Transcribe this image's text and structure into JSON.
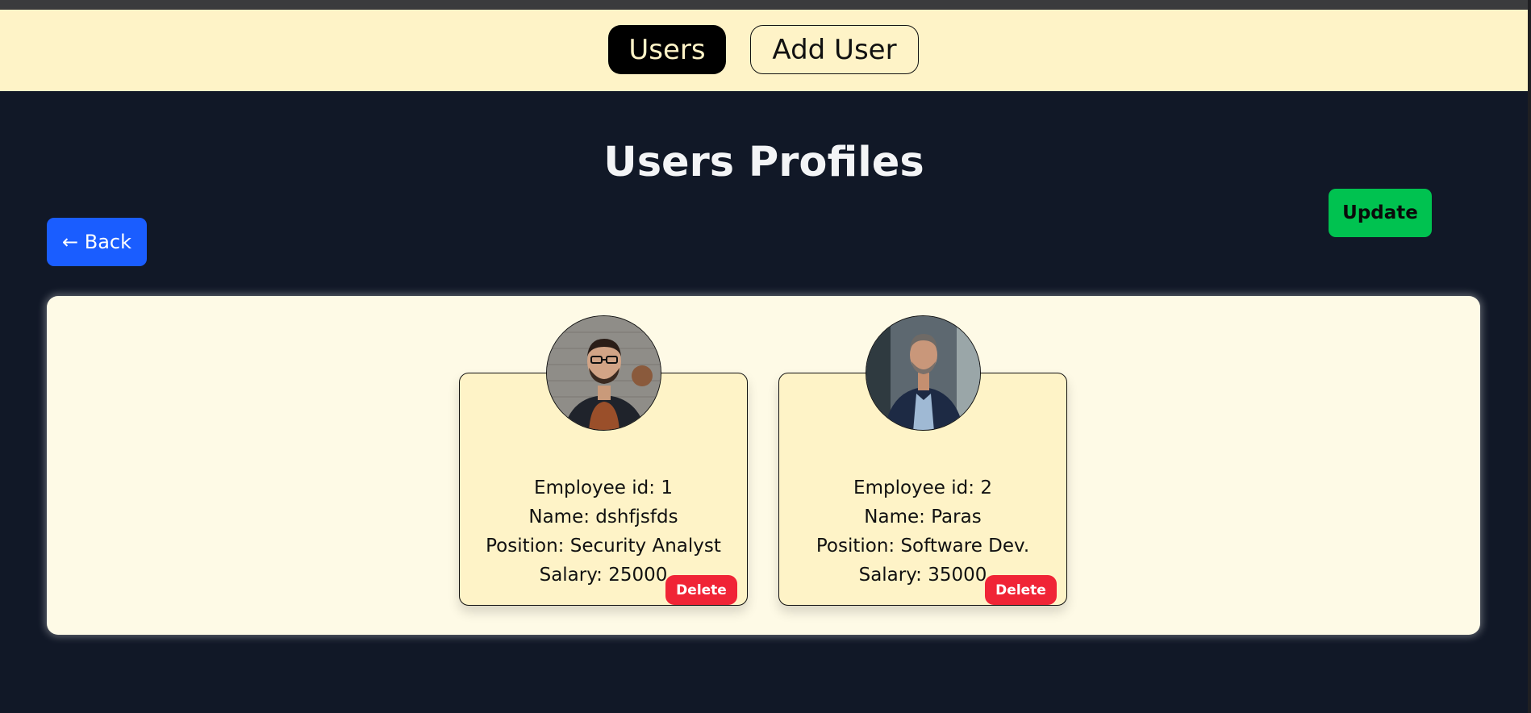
{
  "nav": {
    "users_label": "Users",
    "add_user_label": "Add User"
  },
  "page": {
    "title": "Users Profiles",
    "back_label": "← Back",
    "update_label": "Update"
  },
  "employees": [
    {
      "id_text": "Employee id: 1",
      "name_text": "Name: dshfjsfds",
      "position_text": "Position: Security Analyst",
      "salary_text": "Salary: 25000",
      "delete_label": "Delete",
      "avatar_icon": "person-photo-icon"
    },
    {
      "id_text": "Employee id: 2",
      "name_text": "Name: Paras",
      "position_text": "Position: Software Dev.",
      "salary_text": "Salary: 35000",
      "delete_label": "Delete",
      "avatar_icon": "person-photo-icon"
    }
  ],
  "colors": {
    "background": "#111827",
    "navbar": "#fef3c7",
    "back_button": "#1a5dff",
    "update_button": "#00c250",
    "delete_button": "#f02436",
    "card": "#fef3c7",
    "panel": "#fefae6"
  }
}
